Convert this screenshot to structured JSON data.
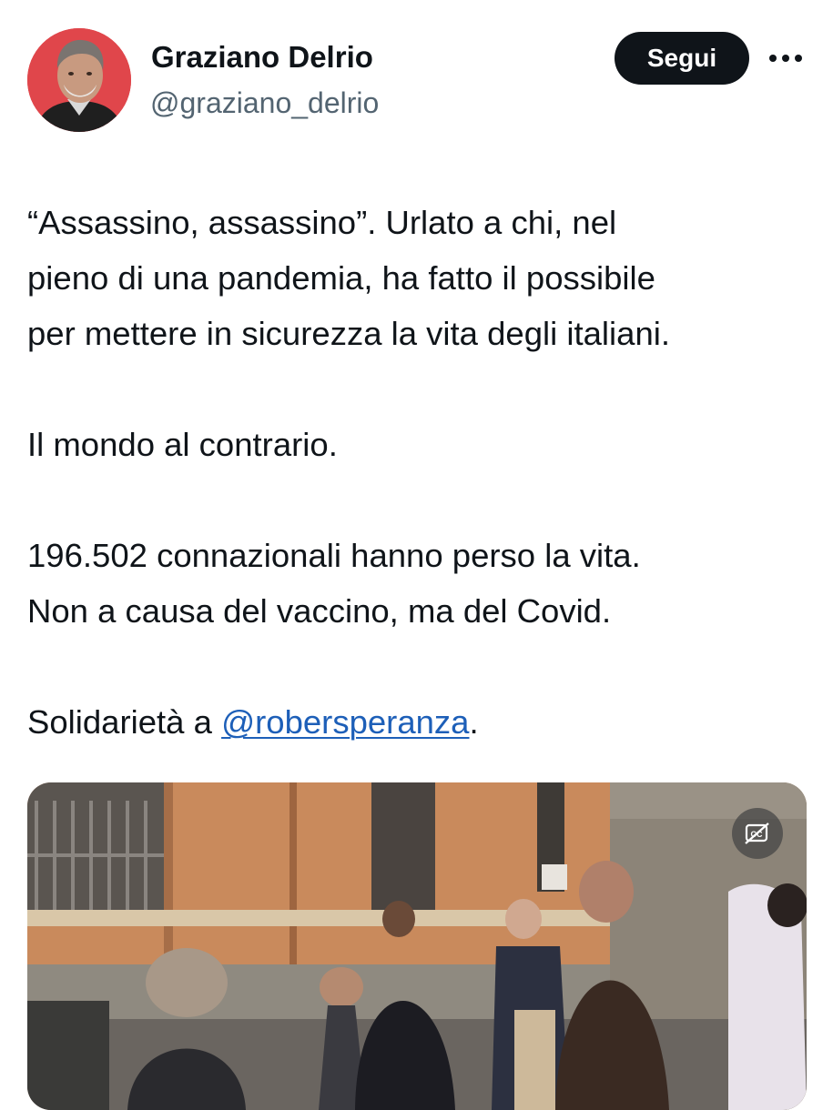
{
  "author": {
    "name": "Graziano Delrio",
    "handle": "@graziano_delrio",
    "avatar_icon": "user-avatar-photo"
  },
  "actions": {
    "follow_label": "Segui",
    "more_icon": "more-horizontal-icon"
  },
  "tweet": {
    "line1": "“Assassino, assassino”. Urlato a chi, nel",
    "line2": "pieno di una pandemia, ha fatto il possibile",
    "line3": "per mettere in sicurezza la vita degli italiani.",
    "line4": "Il mondo al contrario.",
    "line5": "196.502 connazionali hanno perso la vita.",
    "line6": "Non a causa del vaccino, ma del Covid.",
    "solidarity_prefix": "Solidarietà a ",
    "mention": "@robersperanza",
    "solidarity_suffix": "."
  },
  "media": {
    "type": "video",
    "captions_icon": "captions-off-icon"
  },
  "colors": {
    "text": "#0f1419",
    "secondary_text": "#536471",
    "follow_button_bg": "#0f1419",
    "mention": "#1d5fb8",
    "avatar_bg": "#e0464b"
  }
}
